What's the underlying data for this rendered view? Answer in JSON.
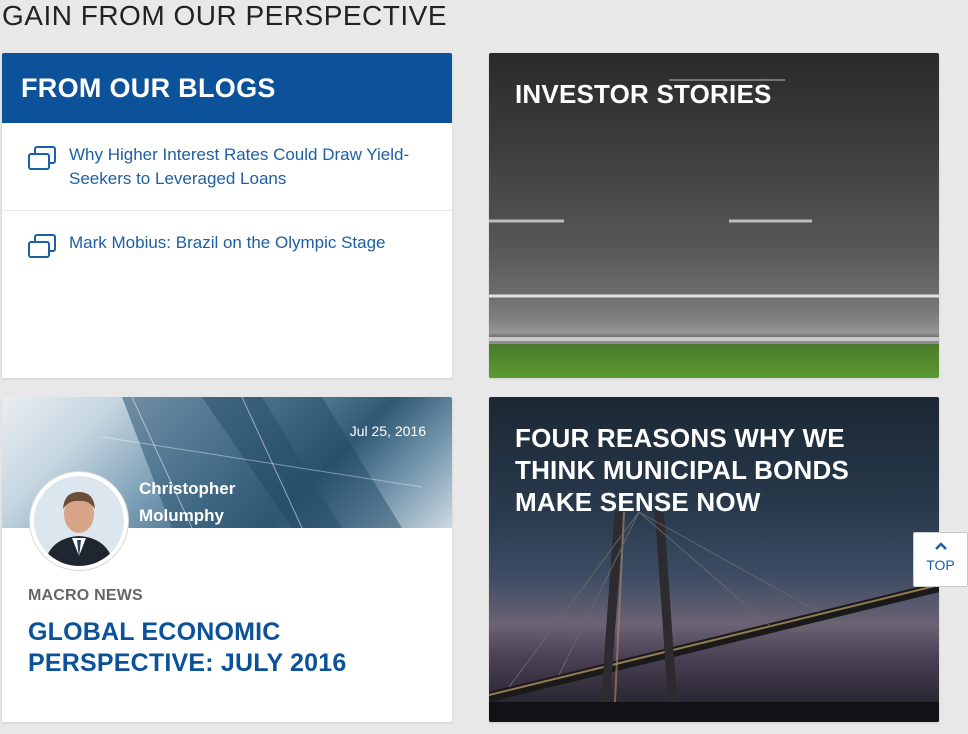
{
  "section": {
    "title": "GAIN FROM OUR PERSPECTIVE"
  },
  "blogs": {
    "header": "FROM OUR BLOGS",
    "items": [
      {
        "title": "Why Higher Interest Rates Could Draw Yield-Seekers to Leveraged Loans"
      },
      {
        "title": "Mark Mobius: Brazil on the Olympic Stage"
      }
    ]
  },
  "investor": {
    "title": "INVESTOR STORIES"
  },
  "macro": {
    "date": "Jul 25, 2016",
    "author": "Christopher Molumphy",
    "category": "MACRO NEWS",
    "headline": "GLOBAL ECONOMIC PERSPECTIVE: JULY 2016"
  },
  "muni": {
    "title": "FOUR REASONS WHY WE THINK MUNICIPAL BONDS MAKE SENSE NOW"
  },
  "top_button": {
    "label": "TOP"
  },
  "colors": {
    "brand_blue": "#0b529a",
    "link_blue": "#1d5fa3"
  },
  "icons": {
    "blog_item": "blog-windows-icon",
    "top_arrow": "chevron-up-icon"
  }
}
